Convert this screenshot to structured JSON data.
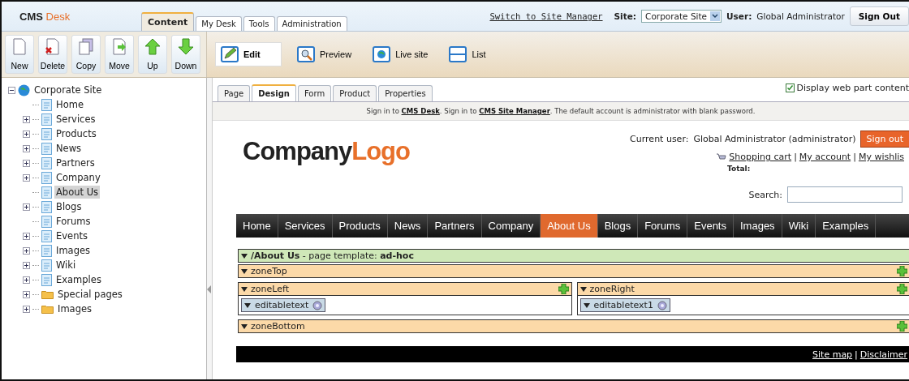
{
  "header": {
    "logo": {
      "primary": "CMS",
      "accent": "Desk"
    },
    "tabs": [
      {
        "label": "Content",
        "selected": true
      },
      {
        "label": "My Desk",
        "selected": false
      },
      {
        "label": "Tools",
        "selected": false
      },
      {
        "label": "Administration",
        "selected": false
      }
    ],
    "switch_link": "Switch to Site Manager",
    "site_label": "Site:",
    "site_value": "Corporate Site",
    "user_label": "User:",
    "user_name": "Global Administrator",
    "sign_out": "Sign Out"
  },
  "toolbar": {
    "actions": [
      {
        "label": "New",
        "kind": "new"
      },
      {
        "label": "Delete",
        "kind": "delete"
      },
      {
        "label": "Copy",
        "kind": "copy"
      },
      {
        "label": "Move",
        "kind": "move"
      },
      {
        "label": "Up",
        "kind": "up"
      },
      {
        "label": "Down",
        "kind": "down"
      }
    ],
    "view_modes": [
      {
        "label": "Edit",
        "kind": "edit",
        "selected": true
      },
      {
        "label": "Preview",
        "kind": "preview",
        "selected": false
      },
      {
        "label": "Live site",
        "kind": "live",
        "selected": false
      },
      {
        "label": "List",
        "kind": "list",
        "selected": false
      }
    ]
  },
  "tree": {
    "label": "Corporate Site",
    "expanded": true,
    "children": [
      {
        "label": "Home",
        "kind": "page",
        "expandable": false,
        "selected": false
      },
      {
        "label": "Services",
        "kind": "page",
        "expandable": true,
        "selected": false
      },
      {
        "label": "Products",
        "kind": "page",
        "expandable": true,
        "selected": false
      },
      {
        "label": "News",
        "kind": "page",
        "expandable": true,
        "selected": false
      },
      {
        "label": "Partners",
        "kind": "page",
        "expandable": true,
        "selected": false
      },
      {
        "label": "Company",
        "kind": "page",
        "expandable": true,
        "selected": false
      },
      {
        "label": "About Us",
        "kind": "page",
        "expandable": false,
        "selected": true
      },
      {
        "label": "Blogs",
        "kind": "page",
        "expandable": true,
        "selected": false
      },
      {
        "label": "Forums",
        "kind": "page",
        "expandable": false,
        "selected": false
      },
      {
        "label": "Events",
        "kind": "page",
        "expandable": true,
        "selected": false
      },
      {
        "label": "Images",
        "kind": "page",
        "expandable": true,
        "selected": false
      },
      {
        "label": "Wiki",
        "kind": "page",
        "expandable": true,
        "selected": false
      },
      {
        "label": "Examples",
        "kind": "page",
        "expandable": true,
        "selected": false
      },
      {
        "label": "Special pages",
        "kind": "folder",
        "expandable": true,
        "selected": false
      },
      {
        "label": "Images",
        "kind": "folder",
        "expandable": true,
        "selected": false
      }
    ]
  },
  "content_tabs": [
    {
      "label": "Page",
      "selected": false
    },
    {
      "label": "Design",
      "selected": true
    },
    {
      "label": "Form",
      "selected": false
    },
    {
      "label": "Product",
      "selected": false
    },
    {
      "label": "Properties",
      "selected": false
    }
  ],
  "display_web_part": {
    "label": "Display web part content",
    "checked": true
  },
  "preview": {
    "notice": {
      "parts": [
        "Sign in to ",
        ". Sign in to ",
        ". The default account is administrator with blank password."
      ],
      "links": [
        "CMS Desk",
        "CMS Site Manager"
      ]
    },
    "logo": {
      "primary": "Company",
      "accent": "Logo"
    },
    "current_user_label": "Current user:",
    "current_user": "Global Administrator (administrator)",
    "sign_out": "Sign out",
    "cart_links": [
      "Shopping cart",
      "My account",
      "My wishlis"
    ],
    "separator": "|",
    "total_label": "Total:",
    "search_label": "Search:",
    "menu": [
      {
        "label": "Home",
        "selected": false
      },
      {
        "label": "Services",
        "selected": false
      },
      {
        "label": "Products",
        "selected": false
      },
      {
        "label": "News",
        "selected": false
      },
      {
        "label": "Partners",
        "selected": false
      },
      {
        "label": "Company",
        "selected": false
      },
      {
        "label": "About Us",
        "selected": true
      },
      {
        "label": "Blogs",
        "selected": false
      },
      {
        "label": "Forums",
        "selected": false
      },
      {
        "label": "Events",
        "selected": false
      },
      {
        "label": "Images",
        "selected": false
      },
      {
        "label": "Wiki",
        "selected": false
      },
      {
        "label": "Examples",
        "selected": false
      }
    ],
    "template": {
      "path": "/About Us",
      "text": " - page template: ",
      "name": "ad-hoc"
    },
    "zone_top": "zoneTop",
    "columns": [
      {
        "zone": "zoneLeft",
        "webpart": "editabletext"
      },
      {
        "zone": "zoneRight",
        "webpart": "editabletext1"
      }
    ],
    "zone_bottom": "zoneBottom",
    "footer_links": [
      "Site map",
      "Disclaimer"
    ]
  }
}
